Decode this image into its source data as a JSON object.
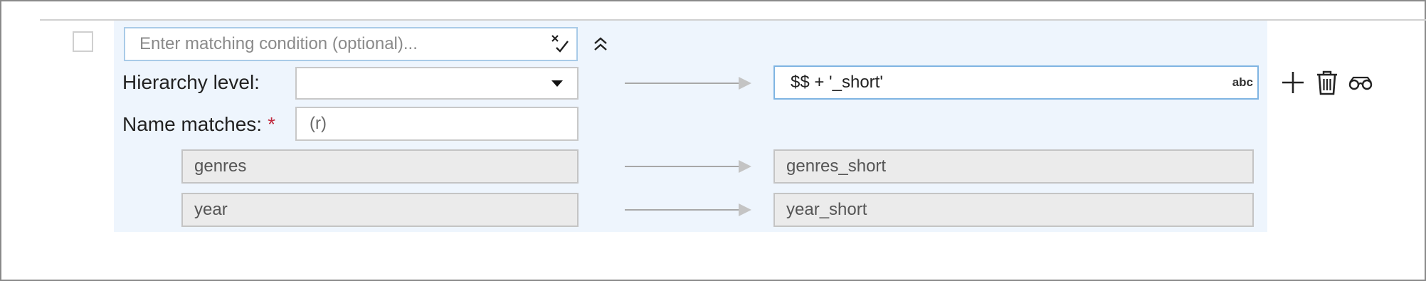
{
  "condition": {
    "placeholder": "Enter matching condition (optional)...",
    "icon": "clear-check-icon"
  },
  "collapse_icon": "chevron-double-up-icon",
  "hierarchy": {
    "label": "Hierarchy level:",
    "selected": ""
  },
  "name_matches": {
    "label": "Name matches:",
    "required_marker": "*",
    "value": "(r)"
  },
  "expression": {
    "value": "$$ + '_short'",
    "type_badge": "abc"
  },
  "previews": [
    {
      "source": "genres",
      "target": "genres_short"
    },
    {
      "source": "year",
      "target": "year_short"
    }
  ],
  "actions": [
    "add-icon",
    "delete-icon",
    "preview-glasses-icon"
  ],
  "colors": {
    "panel_background": "#eef5fd",
    "focus_border": "#7fb4e2",
    "required": "#c0283d",
    "readonly_field": "#ebebeb"
  }
}
